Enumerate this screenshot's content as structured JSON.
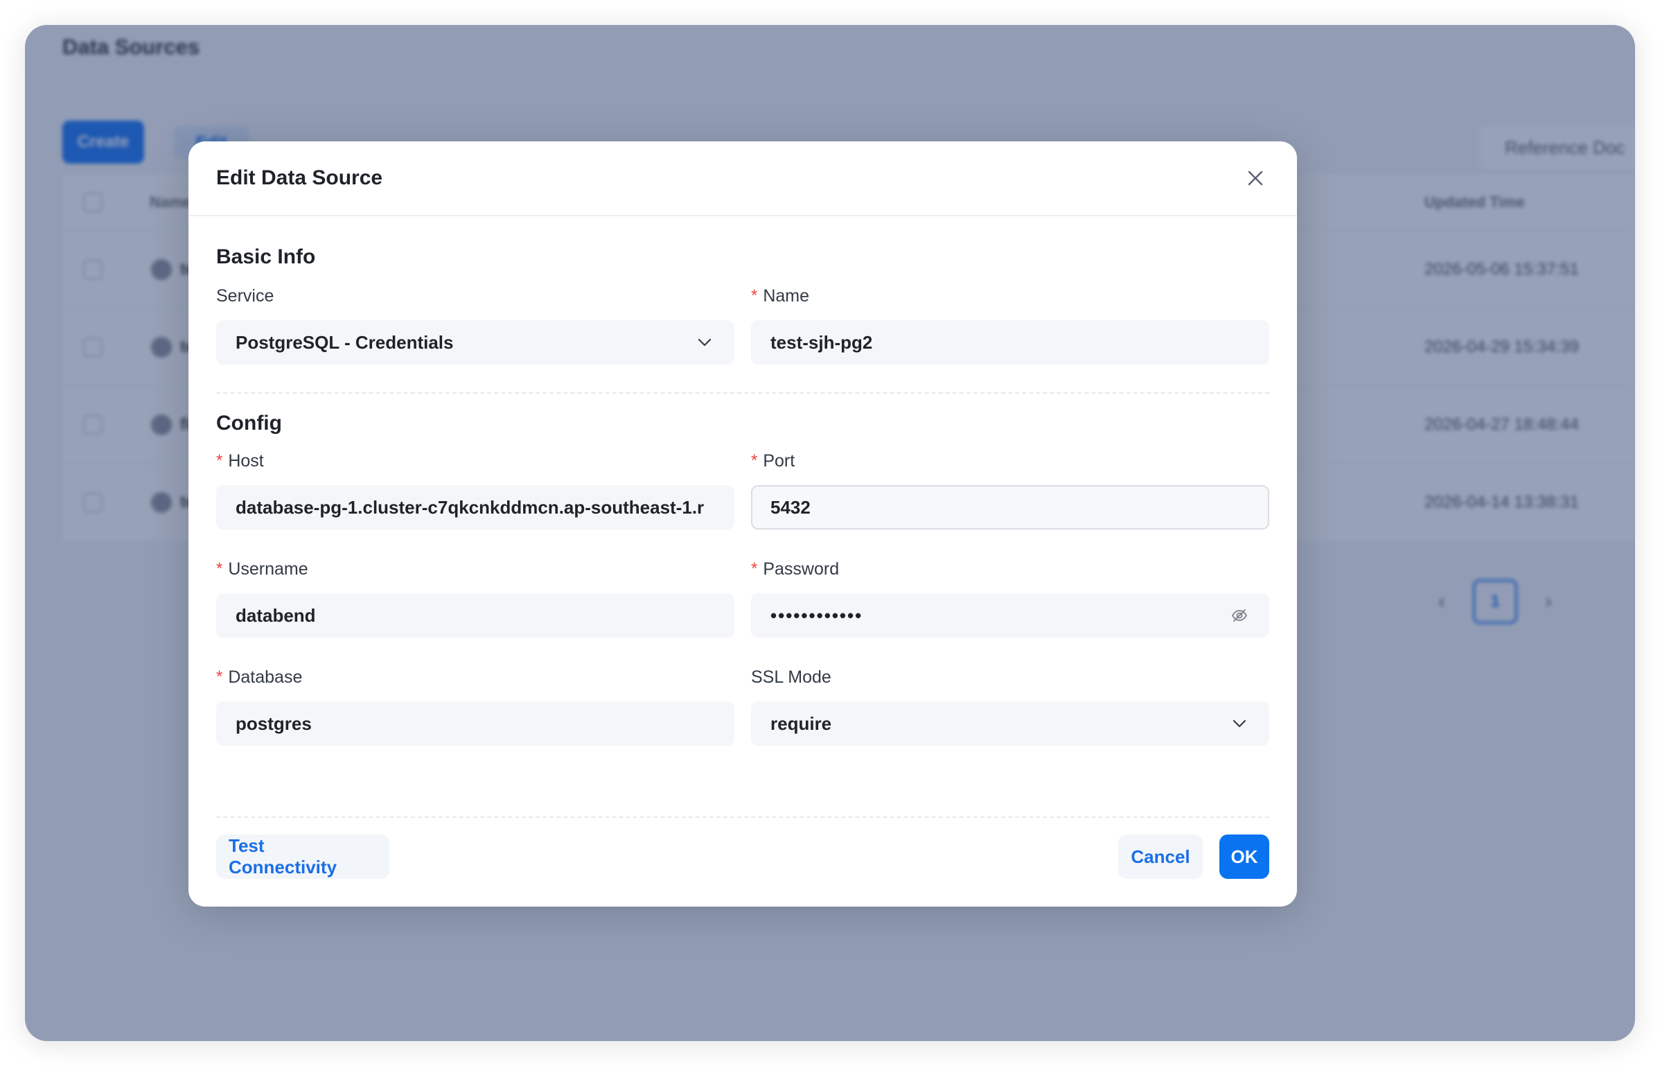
{
  "background": {
    "page_title": "Data Sources",
    "create_label": "Create",
    "edit_label": "Edit",
    "reference_doc_label": "Reference Doc",
    "table": {
      "col_name": "Name",
      "col_updated": "Updated Time",
      "rows": [
        {
          "name": "test",
          "updated": "2026-05-06 15:37:51"
        },
        {
          "name": "test",
          "updated": "2026-04-29 15:34:39"
        },
        {
          "name": "fish",
          "updated": "2026-04-27 18:48:44"
        },
        {
          "name": "test",
          "updated": "2026-04-14 13:38:31"
        }
      ]
    },
    "pager": {
      "current": "1"
    }
  },
  "modal": {
    "title": "Edit Data Source",
    "basic_info": {
      "section_title": "Basic Info",
      "service_label": "Service",
      "service_value": "PostgreSQL - Credentials",
      "name_label": "Name",
      "name_value": "test-sjh-pg2"
    },
    "config": {
      "section_title": "Config",
      "host_label": "Host",
      "host_value": "database-pg-1.cluster-c7qkcnkddmcn.ap-southeast-1.r",
      "port_label": "Port",
      "port_value": "5432",
      "username_label": "Username",
      "username_value": "databend",
      "password_label": "Password",
      "password_value": "••••••••••••",
      "database_label": "Database",
      "database_value": "postgres",
      "ssl_label": "SSL Mode",
      "ssl_value": "require"
    },
    "footer": {
      "test_label": "Test Connectivity",
      "cancel_label": "Cancel",
      "ok_label": "OK"
    }
  },
  "colors": {
    "primary": "#0a73f0",
    "required": "#f04343",
    "overlay": "#2f4470"
  },
  "icons": {
    "close": "close-icon",
    "chevron": "chevron-down-icon",
    "eye_off": "eye-off-icon"
  }
}
